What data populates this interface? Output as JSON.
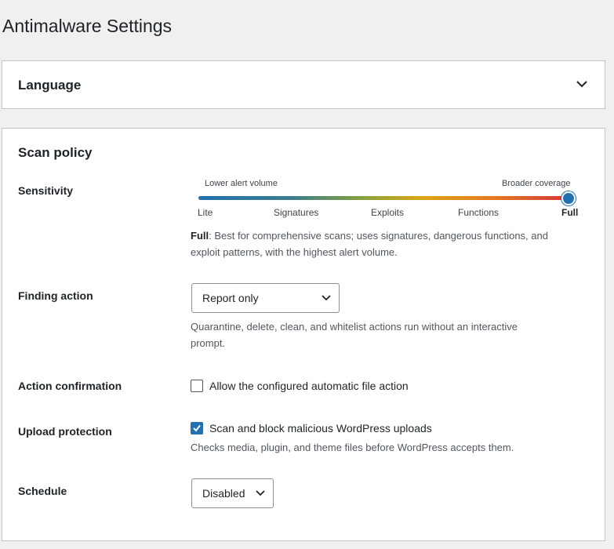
{
  "page": {
    "title": "Antimalware Settings"
  },
  "language": {
    "title": "Language"
  },
  "scan_policy": {
    "title": "Scan policy",
    "sensitivity": {
      "label": "Sensitivity",
      "low_hint": "Lower alert volume",
      "high_hint": "Broader coverage",
      "levels": [
        "Lite",
        "Signatures",
        "Exploits",
        "Functions",
        "Full"
      ],
      "selected": "Full",
      "selected_level_fraction": 1.0,
      "description_title": "Full",
      "description_line1": ": Best for comprehensive scans; uses signatures, dangerous functions, and",
      "description_line2": "exploit patterns, with the highest alert volume."
    },
    "finding_action": {
      "label": "Finding action",
      "value": "Report only",
      "help_line1": "Quarantine, delete, clean, and whitelist actions run without an interactive",
      "help_line2": "prompt."
    },
    "action_confirmation": {
      "label": "Action confirmation",
      "checkbox_label": "Allow the configured automatic file action",
      "checked": false
    },
    "upload_protection": {
      "label": "Upload protection",
      "checkbox_label": "Scan and block malicious WordPress uploads",
      "checked": true,
      "help": "Checks media, plugin, and theme files before WordPress accepts them."
    },
    "schedule": {
      "label": "Schedule",
      "value": "Disabled"
    }
  },
  "colors": {
    "accent": "#2271b1",
    "background": "#f0f0f1",
    "border": "#c3c4c7"
  }
}
